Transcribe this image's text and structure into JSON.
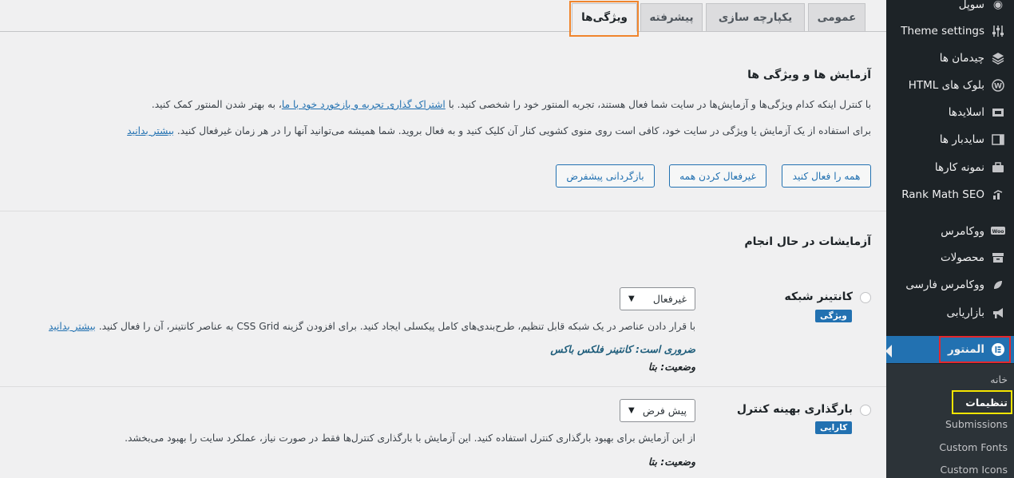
{
  "sidebar": {
    "items": [
      {
        "label": "سوپل",
        "icon": "soul-icon"
      },
      {
        "label": "Theme settings",
        "icon": "sliders-icon"
      },
      {
        "label": "چیدمان ها",
        "icon": "layers-icon"
      },
      {
        "label": "بلوک های HTML",
        "icon": "wordpress-icon"
      },
      {
        "label": "اسلایدها",
        "icon": "slides-icon"
      },
      {
        "label": "سایدبار ها",
        "icon": "sidebar-icon"
      },
      {
        "label": "نمونه کارها",
        "icon": "portfolio-icon"
      },
      {
        "label": "Rank Math SEO",
        "icon": "rankmath-icon"
      },
      {
        "label": "ووکامرس",
        "icon": "woo-icon"
      },
      {
        "label": "محصولات",
        "icon": "archive-icon"
      },
      {
        "label": "ووکامرس فارسی",
        "icon": "woo-persian-icon"
      },
      {
        "label": "بازاریابی",
        "icon": "megaphone-icon"
      },
      {
        "label": "المنتور",
        "icon": "elementor-icon"
      }
    ],
    "submenu": [
      "خانه",
      "تنظیمات",
      "Submissions",
      "Custom Fonts",
      "Custom Icons"
    ]
  },
  "tabs": [
    "عمومی",
    "یکپارچه سازی",
    "پیشرفته",
    "ویژگی‌ها"
  ],
  "section": {
    "title": "آزمایش ها و ویژگی ها",
    "para1_before": "با کنترل اینکه کدام ویژگی‌ها و آزمایش‌ها در سایت شما فعال هستند، تجربه المنتور خود را شخصی کنید. با ",
    "para1_link": "اشتراک گذاری تجربه و بازخورد خود با ما",
    "para1_after": "، به بهتر شدن المنتور کمک کنید.",
    "para2_before": "برای استفاده از یک آزمایش یا ویژگی در سایت خود، کافی است روی منوی کشویی کنار آن کلیک کنید و به فعال بروید. شما همیشه می‌توانید آنها را در هر زمان غیرفعال کنید. ",
    "para2_link": "بیشتر بدانید",
    "buttons": [
      "همه را فعال کنید",
      "غیرفعال کردن همه",
      "بازگردانی پیشفرض"
    ]
  },
  "ongoing": {
    "title": "آزمایشات در حال انجام",
    "features": [
      {
        "name": "کانتینر شبکه",
        "tag": "ویژگی",
        "select": "غیرفعال",
        "desc": "با قرار دادن عناصر در یک شبکه قابل تنظیم، طرح‌بندی‌های کامل پیکسلی ایجاد کنید. برای افزودن گزینه CSS Grid به عناصر کانتینر، آن را فعال کنید. ",
        "desc_link": "بیشتر بدانید",
        "required": "ضروری است: کانتینر فلکس باکس",
        "status": "وضعیت: بتا"
      },
      {
        "name": "بارگذاری بهینه کنترل",
        "tag": "کارایی",
        "select": "پیش فرض",
        "desc": "از این آزمایش برای بهبود بارگذاری کنترل استفاده کنید. این آزمایش با بارگذاری کنترل‌ها فقط در صورت نیاز، عملکرد سایت را بهبود می‌بخشد.",
        "status": "وضعیت: بتا"
      }
    ]
  },
  "colors": {
    "accent": "#2271b1",
    "sidebar_bg": "#1d2327",
    "tab_highlight": "#f0852d",
    "menu_highlight": "#e3282e",
    "submenu_highlight": "#f5e500"
  }
}
